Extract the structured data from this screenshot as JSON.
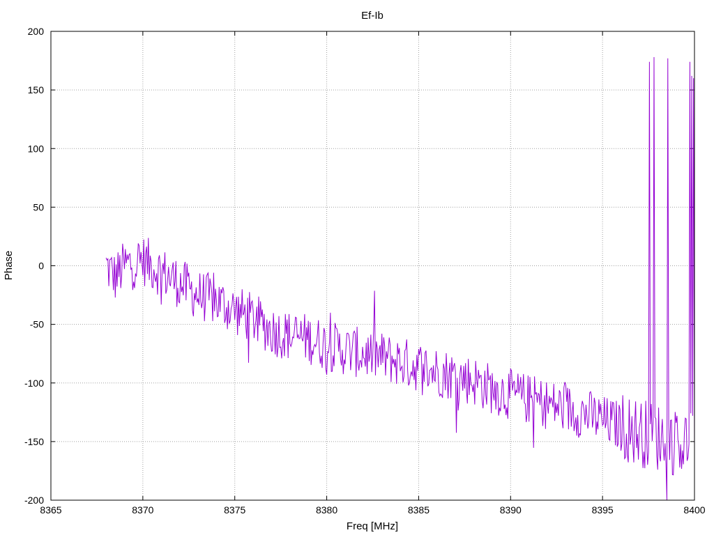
{
  "chart_data": {
    "type": "line",
    "title": "Ef-Ib",
    "xlabel": "Freq [MHz]",
    "ylabel": "Phase",
    "xlim": [
      8365,
      8400
    ],
    "ylim": [
      -200,
      200
    ],
    "grid": true,
    "x_ticks": [
      "8365",
      "8370",
      "8375",
      "8380",
      "8385",
      "8390",
      "8395",
      "8400"
    ],
    "y_ticks": [
      "-200",
      "-150",
      "-100",
      "-50",
      "0",
      "50",
      "100",
      "150",
      "200"
    ],
    "series": [
      {
        "color": "#9400d3",
        "start_x": 8368.0,
        "step_x": 0.05,
        "points_count": 641,
        "note_trend": "noisy phase ramp from about 0 at 8368 MHz to about -150 at 8400 MHz with wrap spikes to about 175 near 8397.5-8400 MHz",
        "anchors": [
          [
            8368.0,
            0
          ],
          [
            8368.5,
            -10
          ],
          [
            8369.0,
            0
          ],
          [
            8370.0,
            5
          ],
          [
            8371.0,
            -5
          ],
          [
            8372.0,
            -15
          ],
          [
            8373.0,
            -25
          ],
          [
            8374.0,
            -30
          ],
          [
            8375.0,
            -38
          ],
          [
            8376.0,
            -45
          ],
          [
            8377.0,
            -55
          ],
          [
            8378.0,
            -60
          ],
          [
            8379.0,
            -62
          ],
          [
            8380.0,
            -68
          ],
          [
            8381.0,
            -72
          ],
          [
            8382.0,
            -75
          ],
          [
            8383.0,
            -78
          ],
          [
            8384.0,
            -82
          ],
          [
            8385.0,
            -86
          ],
          [
            8386.0,
            -90
          ],
          [
            8387.0,
            -94
          ],
          [
            8388.0,
            -98
          ],
          [
            8389.0,
            -105
          ],
          [
            8390.0,
            -110
          ],
          [
            8391.0,
            -114
          ],
          [
            8392.0,
            -118
          ],
          [
            8393.0,
            -122
          ],
          [
            8394.0,
            -126
          ],
          [
            8395.0,
            -132
          ],
          [
            8396.0,
            -137
          ],
          [
            8397.0,
            -142
          ],
          [
            8398.0,
            -146
          ],
          [
            8399.0,
            -150
          ],
          [
            8400.0,
            -152
          ]
        ],
        "spikes": [
          [
            8397.55,
            174
          ],
          [
            8397.8,
            178
          ],
          [
            8398.55,
            177
          ],
          [
            8399.75,
            174
          ],
          [
            8399.85,
            162
          ],
          [
            8399.95,
            160
          ]
        ]
      }
    ]
  }
}
